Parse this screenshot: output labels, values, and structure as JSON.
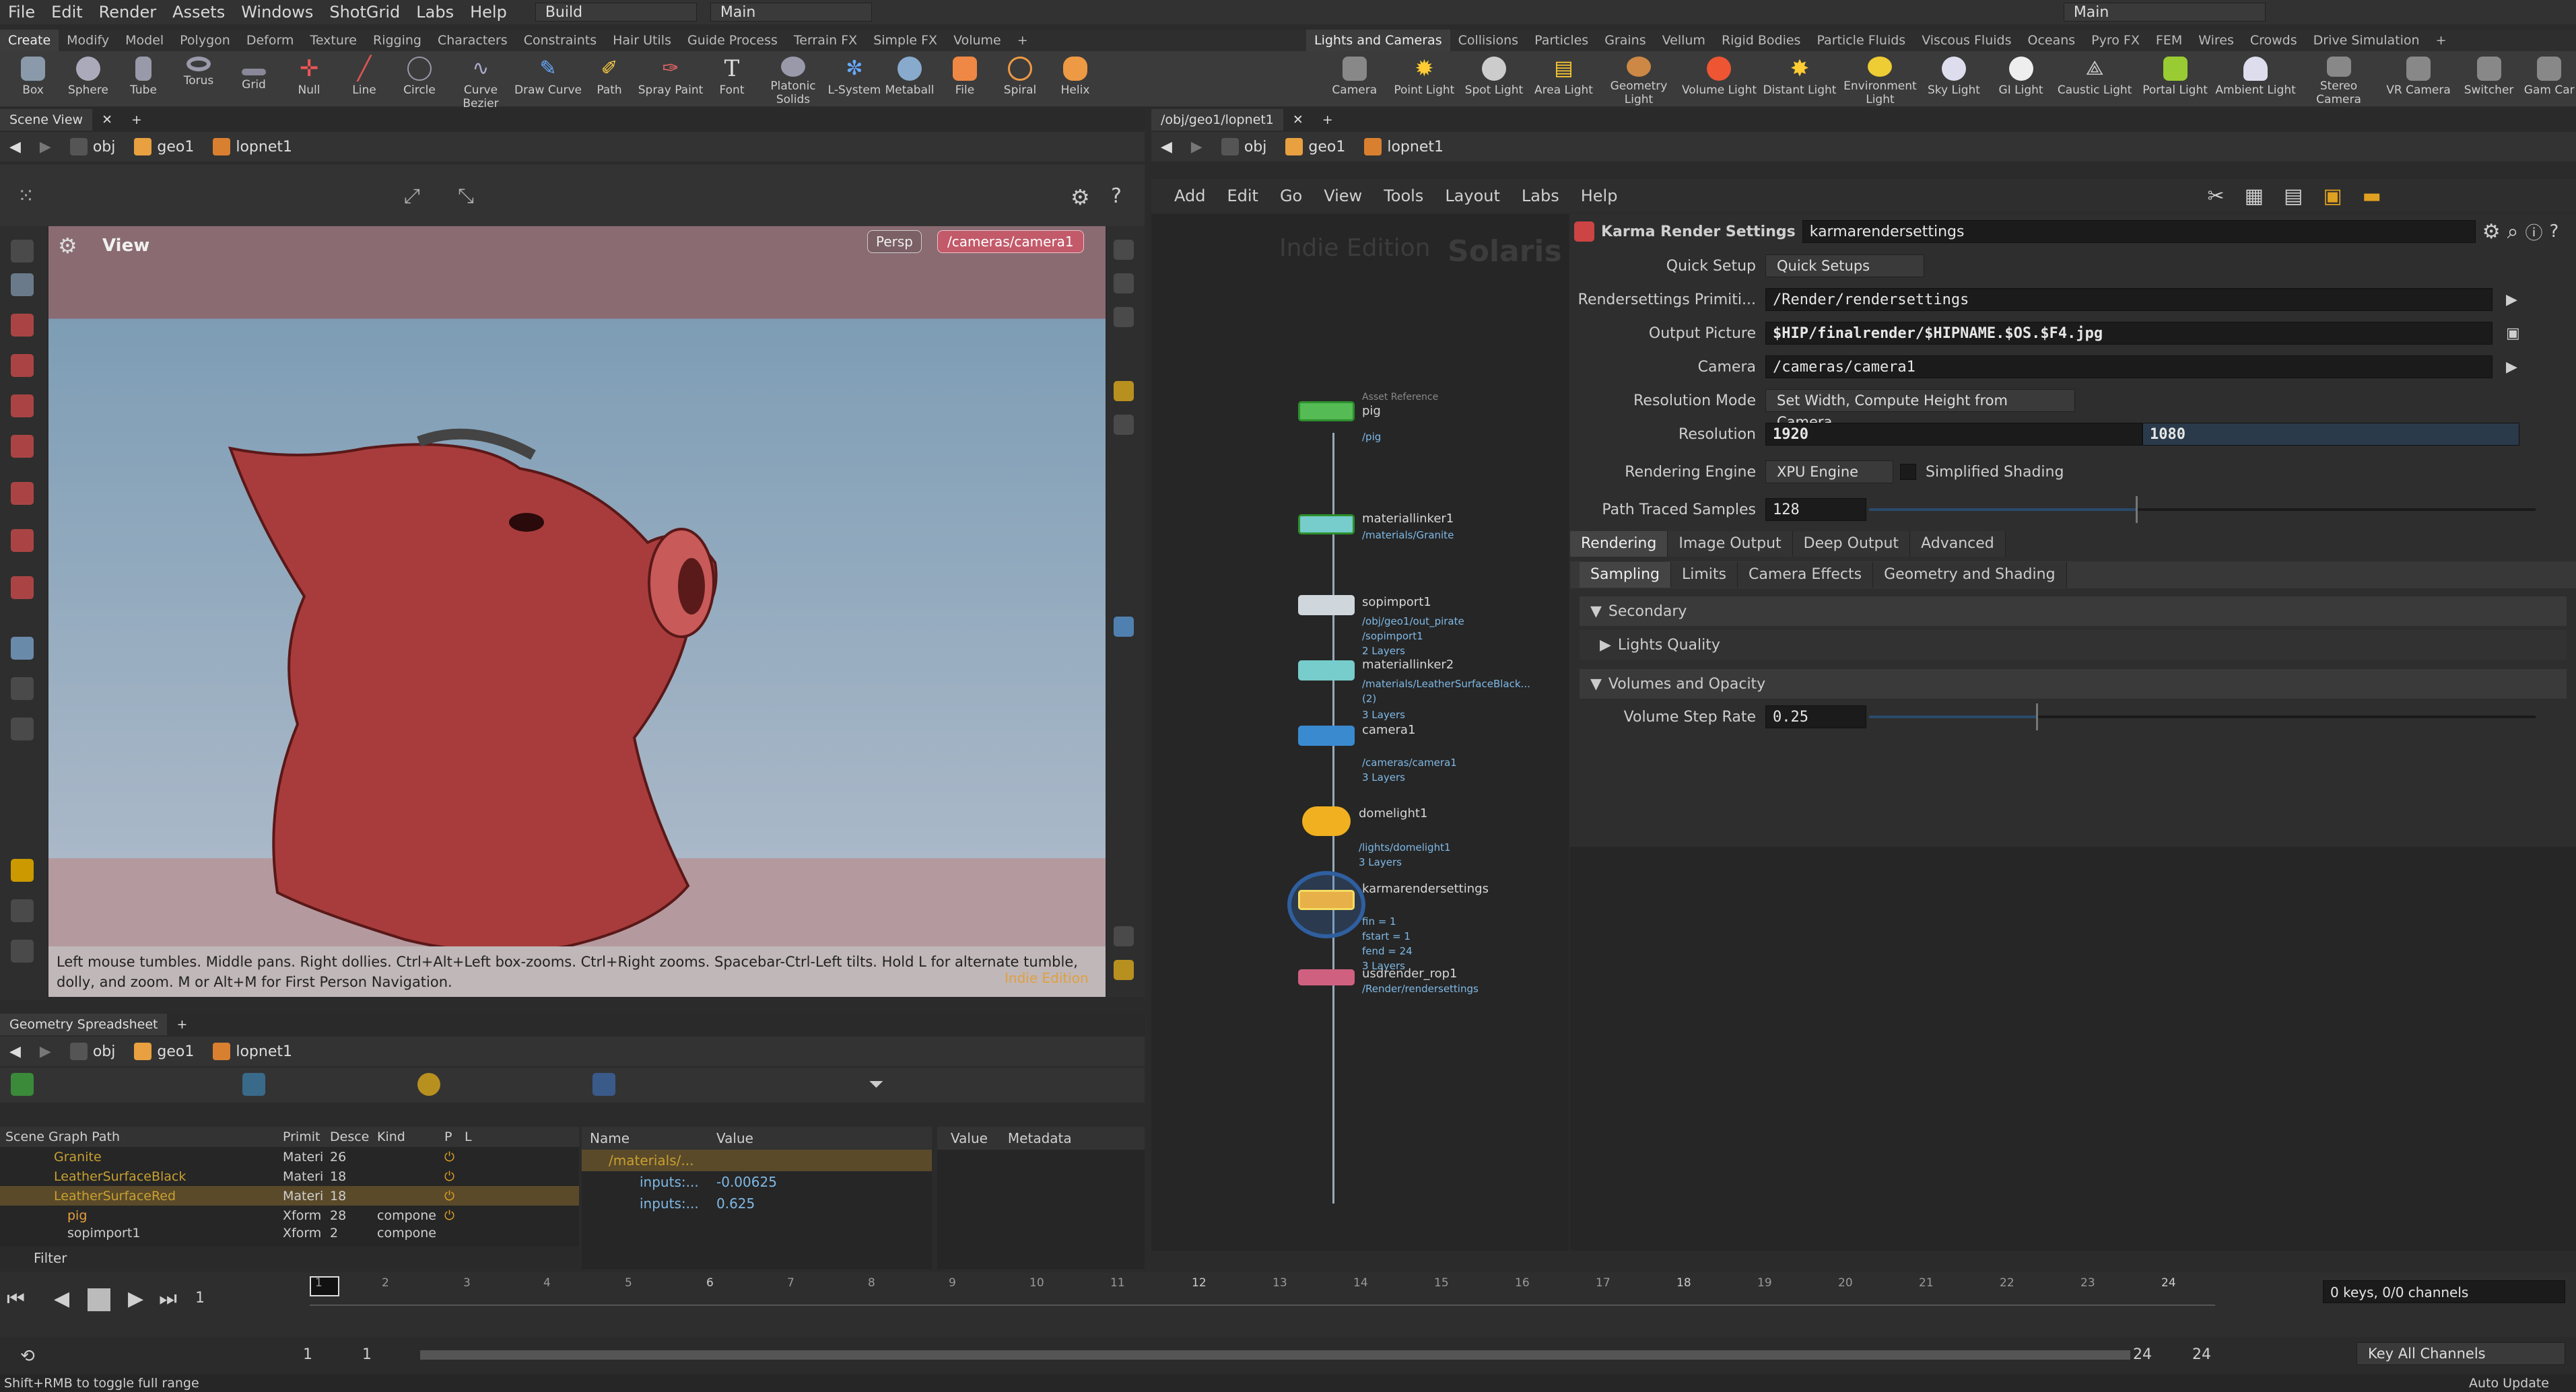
{
  "menu": {
    "items": [
      "File",
      "Edit",
      "Render",
      "Assets",
      "Windows",
      "ShotGrid",
      "Labs",
      "Help"
    ],
    "desktop": "Build",
    "context": "Main",
    "right_context": "Main"
  },
  "shelf_left": {
    "tabs": [
      "Create",
      "Modify",
      "Model",
      "Polygon",
      "Deform",
      "Texture",
      "Rigging",
      "Characters",
      "Constraints",
      "Hair Utils",
      "Guide Process",
      "Terrain FX",
      "Simple FX",
      "Volume"
    ],
    "tools": [
      "Box",
      "Sphere",
      "Tube",
      "Torus",
      "Grid",
      "Null",
      "Line",
      "Circle",
      "Curve Bezier",
      "Draw Curve",
      "Path",
      "Spray Paint",
      "Font",
      "Platonic Solids",
      "L-System",
      "Metaball",
      "File",
      "Spiral",
      "Helix"
    ]
  },
  "shelf_right": {
    "tabs": [
      "Lights and Cameras",
      "Collisions",
      "Particles",
      "Grains",
      "Vellum",
      "Rigid Bodies",
      "Particle Fluids",
      "Viscous Fluids",
      "Oceans",
      "Pyro FX",
      "FEM",
      "Wires",
      "Crowds",
      "Drive Simulation"
    ],
    "tools": [
      "Camera",
      "Point Light",
      "Spot Light",
      "Area Light",
      "Geometry Light",
      "Volume Light",
      "Distant Light",
      "Environment Light",
      "Sky Light",
      "GI Light",
      "Caustic Light",
      "Portal Light",
      "Ambient Light",
      "Stereo Camera",
      "VR Camera",
      "Switcher",
      "Gam Car"
    ]
  },
  "scene_view": {
    "tab": "Scene View",
    "path": [
      "obj",
      "geo1",
      "lopnet1"
    ],
    "view_label": "View",
    "persp": "Persp",
    "camera": "/cameras/camera1",
    "hint": "Left mouse tumbles. Middle pans. Right dollies. Ctrl+Alt+Left box-zooms. Ctrl+Right zooms. Spacebar-Ctrl-Left tilts. Hold L for alternate tumble, dolly, and zoom. M or Alt+M for First Person Navigation.",
    "watermark": "Indie Edition"
  },
  "network": {
    "tab": "/obj/geo1/lopnet1",
    "path": [
      "obj",
      "geo1",
      "lopnet1"
    ],
    "menu": [
      "Add",
      "Edit",
      "Go",
      "View",
      "Tools",
      "Layout",
      "Labs",
      "Help"
    ],
    "watermark1": "Indie Edition",
    "watermark2": "Solaris",
    "nodes": [
      {
        "name": "pig",
        "top": "Asset Reference",
        "sub": "/pig"
      },
      {
        "name": "materiallinker1",
        "sub": "/materials/Granite"
      },
      {
        "name": "sopimport1",
        "sub": "/obj/geo1/out_pirate",
        "sub2": "/sopimport1",
        "sub3": "2 Layers"
      },
      {
        "name": "materiallinker2",
        "sub": "/materials/LeatherSurfaceBlack...",
        "sub2": "(2)",
        "sub3": "3 Layers"
      },
      {
        "name": "camera1",
        "sub": "/cameras/camera1",
        "sub3": "3 Layers"
      },
      {
        "name": "domelight1",
        "sub": "/lights/domelight1",
        "sub3": "3 Layers"
      },
      {
        "name": "karmarendersettings",
        "sub": "fin = 1",
        "sub2": "fstart = 1",
        "sub3": "fend = 24",
        "sub4": "3 Layers"
      },
      {
        "name": "usdrender_rop1",
        "sub": "/Render/rendersettings"
      }
    ]
  },
  "params": {
    "type": "Karma Render Settings",
    "node_name": "karmarendersettings",
    "quick_setup_label": "Quick Setup",
    "quick_setup_value": "Quick Setups",
    "rs_prim_label": "Rendersettings Primiti...",
    "rs_prim_value": "/Render/rendersettings",
    "output_label": "Output Picture",
    "output_value": "$HIP/finalrender/$HIPNAME.$OS.$F4.jpg",
    "camera_label": "Camera",
    "camera_value": "/cameras/camera1",
    "resmode_label": "Resolution Mode",
    "resmode_value": "Set Width, Compute Height from Camera",
    "res_label": "Resolution",
    "res_w": "1920",
    "res_h": "1080",
    "engine_label": "Rendering Engine",
    "engine_value": "XPU Engine",
    "simplified": "Simplified Shading",
    "pts_label": "Path Traced Samples",
    "pts_value": "128",
    "pts_fraction": 0.4,
    "tabs": [
      "Rendering",
      "Image Output",
      "Deep Output",
      "Advanced"
    ],
    "subtabs": [
      "Sampling",
      "Limits",
      "Camera Effects",
      "Geometry and Shading"
    ],
    "f_secondary": "Secondary",
    "f_lights": "Lights Quality",
    "f_volumes": "Volumes and Opacity",
    "vsr_label": "Volume Step Rate",
    "vsr_value": "0.25",
    "vsr_fraction": 0.25
  },
  "spreadsheet": {
    "tab": "Geometry Spreadsheet",
    "path": [
      "obj",
      "geo1",
      "lopnet1"
    ],
    "cols": [
      "Scene Graph Path",
      "Primit",
      "Desce",
      "Kind",
      "P",
      "L"
    ],
    "rows": [
      {
        "name": "Granite",
        "type": "Materi",
        "count": "26",
        "kind": ""
      },
      {
        "name": "LeatherSurfaceBlack",
        "type": "Materi",
        "count": "18",
        "kind": ""
      },
      {
        "name": "LeatherSurfaceRed",
        "type": "Materi",
        "count": "18",
        "kind": ""
      },
      {
        "name": "pig",
        "type": "Xform",
        "count": "28",
        "kind": "compone"
      },
      {
        "name": "sopimport1",
        "type": "Xform",
        "count": "2",
        "kind": "compone"
      }
    ],
    "filter": "Filter",
    "mid_cols": [
      "Name",
      "Value"
    ],
    "mid_rows": [
      {
        "name": "/materials/...",
        "value": ""
      },
      {
        "name": "inputs:...",
        "value": "-0.00625"
      },
      {
        "name": "inputs:...",
        "value": "0.625"
      }
    ],
    "right_cols": [
      "Value",
      "Metadata"
    ]
  },
  "timeline": {
    "ticks": [
      "1",
      "2",
      "3",
      "4",
      "5",
      "6",
      "7",
      "8",
      "9",
      "10",
      "11",
      "12",
      "13",
      "14",
      "15",
      "16",
      "17",
      "18",
      "19",
      "20",
      "21",
      "22",
      "23",
      "24"
    ],
    "frame": "1",
    "start": "1",
    "start2": "1",
    "end": "24",
    "end2": "24",
    "keys": "0 keys, 0/0 channels",
    "key_all": "Key All Channels",
    "auto": "Auto Update"
  },
  "status": "Shift+RMB to toggle full range",
  "colors": {
    "accent": "#f0a020",
    "node_green": "#3fa03f",
    "viewport_top": "#8a6a70"
  }
}
